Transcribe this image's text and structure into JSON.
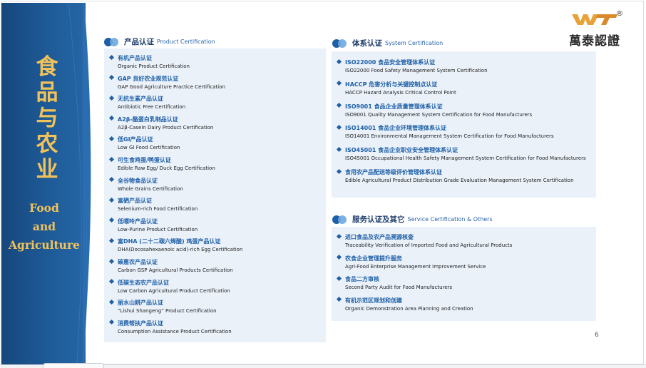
{
  "side": {
    "title_chars": [
      "食",
      "品",
      "与",
      "农",
      "业"
    ],
    "en_line1": "Food",
    "en_line2": "and",
    "en_line3": "Agriculture"
  },
  "logo": {
    "mark": "WT",
    "reg": "®",
    "company": "萬泰認證"
  },
  "product": {
    "title_cn": "产品认证",
    "title_en": "Product Certification",
    "items": [
      {
        "cn": "有机产品认证",
        "en": "Organic Product Certification"
      },
      {
        "cn": "GAP 良好农业规范认证",
        "en": "GAP Good Agriculture Practice Certification"
      },
      {
        "cn": "无抗生素产品认证",
        "en": "Antibiotic Free Certification"
      },
      {
        "cn": "A2β-酪蛋白乳制品认证",
        "en": "A2β-Casein Dairy Product Certification"
      },
      {
        "cn": "低GI产品认证",
        "en": "Low GI Food Certification"
      },
      {
        "cn": "可生食鸡蛋/鸭蛋认证",
        "en": "Edible Raw Egg/ Duck Egg Certification"
      },
      {
        "cn": "全谷物食品认证",
        "en": "Whole Grains Certification"
      },
      {
        "cn": "富硒产品认证",
        "en": "Selenium-rich Food Certification"
      },
      {
        "cn": "低嘌呤产品认证",
        "en": "Low-Purine Product Certification"
      },
      {
        "cn": "富DHA (二十二碳六烯酸) 鸡蛋产品认证",
        "en": "DHA(Docosahexaenoic acid)-rich Egg Certification"
      },
      {
        "cn": "碳惠农产品认证",
        "en": "Carbon GSP Agricultural Products Certification"
      },
      {
        "cn": "低碳生态农产品认证",
        "en": "Low Carbon Agricultural Product Certification"
      },
      {
        "cn": "丽水山耕产品认证",
        "en": "“Lishui Shangeng”  Product Certification"
      },
      {
        "cn": "消费帮扶产品认证",
        "en": "Consumption Assistance Product Certification"
      }
    ]
  },
  "system": {
    "title_cn": "体系认证",
    "title_en": "System Certification",
    "items": [
      {
        "cn": "ISO22000 食品安全管理体系认证",
        "en": "ISO22000 Food Safety Management System Certification"
      },
      {
        "cn": "HACCP 危害分析与关键控制点认证",
        "en": "HACCP Hazard Analysis Critical Control Point"
      },
      {
        "cn": "ISO9001 食品企业质量管理体系认证",
        "en": "ISO9001 Quality Management System Certification for Food Manufacturers"
      },
      {
        "cn": "ISO14001 食品企业环境管理体系认证",
        "en": "ISO14001 Environmental Management System Certification for Food Manufacturers"
      },
      {
        "cn": "ISO45001 食品企业职业安全管理体系认证",
        "en": "ISO45001 Occupational Health Safety Management System Certification for Food Manufacturers"
      },
      {
        "cn": "食用农产品配送等级评价管理体系认证",
        "en": "Edible Agricultural Product Distribution Grade Evaluation Management System Certification"
      }
    ]
  },
  "service": {
    "title_cn": "服务认证及其它",
    "title_en": "Service Certification & Others",
    "items": [
      {
        "cn": "进口食品及农产品溯源核查",
        "en": "Traceability Verification of Imported Food and Agricultural Products"
      },
      {
        "cn": "农食企业管理提升服务",
        "en": "Agri-Food Enterprise Management Improvement Service"
      },
      {
        "cn": "食品二方审核",
        "en": "Second Party Audit for Food Manufacturers"
      },
      {
        "cn": "有机示范区规划和创建",
        "en": "Organic Demonstration Area Planning and Creation"
      }
    ]
  },
  "page_number": "6"
}
